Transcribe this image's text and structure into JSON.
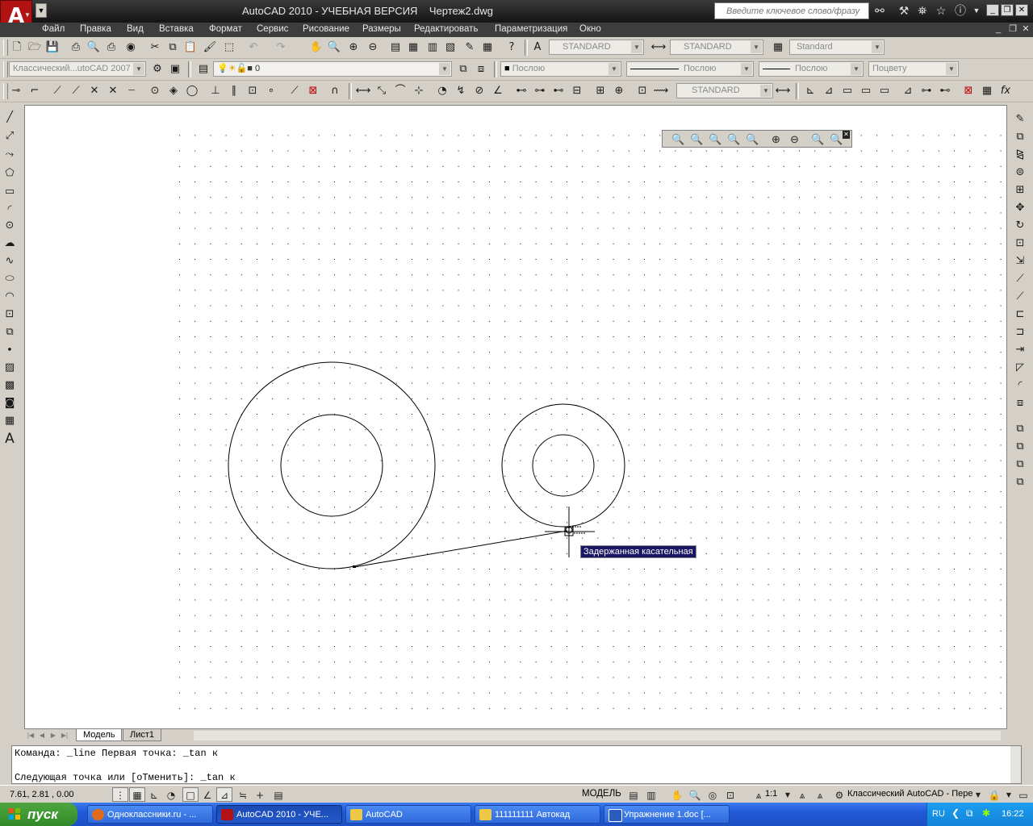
{
  "window": {
    "title": "AutoCAD 2010 - УЧЕБНАЯ ВЕРСИЯ    Чертеж2.dwg",
    "logo_letter": "A",
    "search_placeholder": "Введите ключевое слово/фразу"
  },
  "menubar": {
    "items": [
      "Файл",
      "Правка",
      "Вид",
      "Вставка",
      "Формат",
      "Сервис",
      "Рисование",
      "Размеры",
      "Редактировать",
      "Параметризация",
      "Окно"
    ]
  },
  "toolbars": {
    "text_style": "STANDARD",
    "dim_style": "STANDARD",
    "table_style": "Standard",
    "workspace": "Классический...utoCAD 2007",
    "layer": "0",
    "color": "Послою",
    "linetype": "Послою",
    "lineweight": "Послою",
    "plot_style": "Поцвету",
    "dim_style_2": "STANDARD"
  },
  "drawing": {
    "tooltip": "Задержанная касательная"
  },
  "layout_tabs": [
    "Модель",
    "Лист1"
  ],
  "command_line": {
    "line1": "Команда: _line Первая точка: _tan к",
    "line2": "Следующая точка или [оТменить]: _tan к"
  },
  "statusbar": {
    "coords": "7.61, 2.81 , 0.00",
    "model_label": "МОДЕЛЬ",
    "scale": "1:1",
    "workspace": "Классический AutoCAD - Пере"
  },
  "taskbar": {
    "start": "пуск",
    "tasks": [
      {
        "label": "Одноклассники.ru - ...",
        "active": false
      },
      {
        "label": "AutoCAD 2010 - УЧЕ...",
        "active": true
      },
      {
        "label": "AutoCAD",
        "active": false
      },
      {
        "label": "111111111 Автокад",
        "active": false
      },
      {
        "label": "Упражнение 1.doc [...",
        "active": false
      }
    ],
    "lang": "RU",
    "clock": "16:22"
  },
  "colors": {
    "titlebar": "#1e1e1e",
    "menubar": "#3d3d3d",
    "tooltip_bg": "#1a1663",
    "logo_red": "#b31212",
    "taskbar_blue": "#2259d8",
    "start_green": "#3a9a2e"
  }
}
